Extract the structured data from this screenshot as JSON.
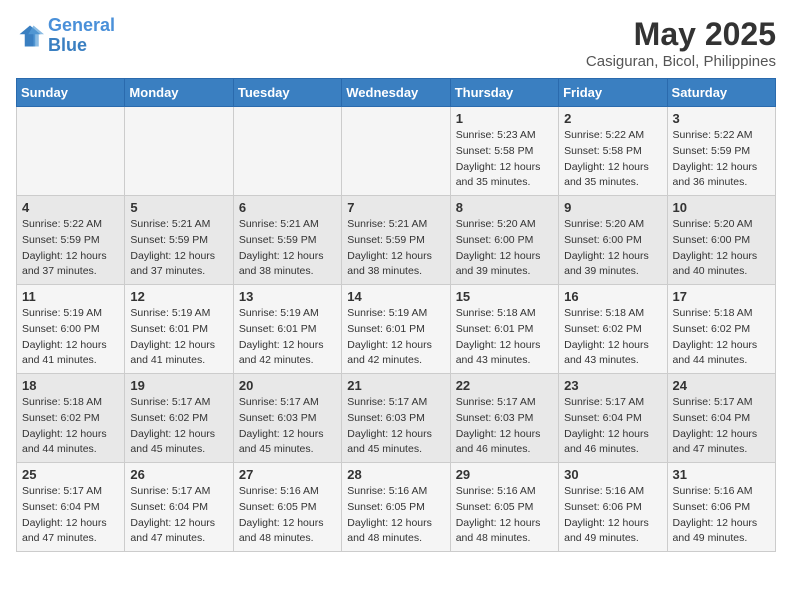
{
  "header": {
    "logo_line1": "General",
    "logo_line2": "Blue",
    "month": "May 2025",
    "location": "Casiguran, Bicol, Philippines"
  },
  "weekdays": [
    "Sunday",
    "Monday",
    "Tuesday",
    "Wednesday",
    "Thursday",
    "Friday",
    "Saturday"
  ],
  "weeks": [
    [
      {
        "day": "",
        "info": ""
      },
      {
        "day": "",
        "info": ""
      },
      {
        "day": "",
        "info": ""
      },
      {
        "day": "",
        "info": ""
      },
      {
        "day": "1",
        "info": "Sunrise: 5:23 AM\nSunset: 5:58 PM\nDaylight: 12 hours\nand 35 minutes."
      },
      {
        "day": "2",
        "info": "Sunrise: 5:22 AM\nSunset: 5:58 PM\nDaylight: 12 hours\nand 35 minutes."
      },
      {
        "day": "3",
        "info": "Sunrise: 5:22 AM\nSunset: 5:59 PM\nDaylight: 12 hours\nand 36 minutes."
      }
    ],
    [
      {
        "day": "4",
        "info": "Sunrise: 5:22 AM\nSunset: 5:59 PM\nDaylight: 12 hours\nand 37 minutes."
      },
      {
        "day": "5",
        "info": "Sunrise: 5:21 AM\nSunset: 5:59 PM\nDaylight: 12 hours\nand 37 minutes."
      },
      {
        "day": "6",
        "info": "Sunrise: 5:21 AM\nSunset: 5:59 PM\nDaylight: 12 hours\nand 38 minutes."
      },
      {
        "day": "7",
        "info": "Sunrise: 5:21 AM\nSunset: 5:59 PM\nDaylight: 12 hours\nand 38 minutes."
      },
      {
        "day": "8",
        "info": "Sunrise: 5:20 AM\nSunset: 6:00 PM\nDaylight: 12 hours\nand 39 minutes."
      },
      {
        "day": "9",
        "info": "Sunrise: 5:20 AM\nSunset: 6:00 PM\nDaylight: 12 hours\nand 39 minutes."
      },
      {
        "day": "10",
        "info": "Sunrise: 5:20 AM\nSunset: 6:00 PM\nDaylight: 12 hours\nand 40 minutes."
      }
    ],
    [
      {
        "day": "11",
        "info": "Sunrise: 5:19 AM\nSunset: 6:00 PM\nDaylight: 12 hours\nand 41 minutes."
      },
      {
        "day": "12",
        "info": "Sunrise: 5:19 AM\nSunset: 6:01 PM\nDaylight: 12 hours\nand 41 minutes."
      },
      {
        "day": "13",
        "info": "Sunrise: 5:19 AM\nSunset: 6:01 PM\nDaylight: 12 hours\nand 42 minutes."
      },
      {
        "day": "14",
        "info": "Sunrise: 5:19 AM\nSunset: 6:01 PM\nDaylight: 12 hours\nand 42 minutes."
      },
      {
        "day": "15",
        "info": "Sunrise: 5:18 AM\nSunset: 6:01 PM\nDaylight: 12 hours\nand 43 minutes."
      },
      {
        "day": "16",
        "info": "Sunrise: 5:18 AM\nSunset: 6:02 PM\nDaylight: 12 hours\nand 43 minutes."
      },
      {
        "day": "17",
        "info": "Sunrise: 5:18 AM\nSunset: 6:02 PM\nDaylight: 12 hours\nand 44 minutes."
      }
    ],
    [
      {
        "day": "18",
        "info": "Sunrise: 5:18 AM\nSunset: 6:02 PM\nDaylight: 12 hours\nand 44 minutes."
      },
      {
        "day": "19",
        "info": "Sunrise: 5:17 AM\nSunset: 6:02 PM\nDaylight: 12 hours\nand 45 minutes."
      },
      {
        "day": "20",
        "info": "Sunrise: 5:17 AM\nSunset: 6:03 PM\nDaylight: 12 hours\nand 45 minutes."
      },
      {
        "day": "21",
        "info": "Sunrise: 5:17 AM\nSunset: 6:03 PM\nDaylight: 12 hours\nand 45 minutes."
      },
      {
        "day": "22",
        "info": "Sunrise: 5:17 AM\nSunset: 6:03 PM\nDaylight: 12 hours\nand 46 minutes."
      },
      {
        "day": "23",
        "info": "Sunrise: 5:17 AM\nSunset: 6:04 PM\nDaylight: 12 hours\nand 46 minutes."
      },
      {
        "day": "24",
        "info": "Sunrise: 5:17 AM\nSunset: 6:04 PM\nDaylight: 12 hours\nand 47 minutes."
      }
    ],
    [
      {
        "day": "25",
        "info": "Sunrise: 5:17 AM\nSunset: 6:04 PM\nDaylight: 12 hours\nand 47 minutes."
      },
      {
        "day": "26",
        "info": "Sunrise: 5:17 AM\nSunset: 6:04 PM\nDaylight: 12 hours\nand 47 minutes."
      },
      {
        "day": "27",
        "info": "Sunrise: 5:16 AM\nSunset: 6:05 PM\nDaylight: 12 hours\nand 48 minutes."
      },
      {
        "day": "28",
        "info": "Sunrise: 5:16 AM\nSunset: 6:05 PM\nDaylight: 12 hours\nand 48 minutes."
      },
      {
        "day": "29",
        "info": "Sunrise: 5:16 AM\nSunset: 6:05 PM\nDaylight: 12 hours\nand 48 minutes."
      },
      {
        "day": "30",
        "info": "Sunrise: 5:16 AM\nSunset: 6:06 PM\nDaylight: 12 hours\nand 49 minutes."
      },
      {
        "day": "31",
        "info": "Sunrise: 5:16 AM\nSunset: 6:06 PM\nDaylight: 12 hours\nand 49 minutes."
      }
    ]
  ]
}
